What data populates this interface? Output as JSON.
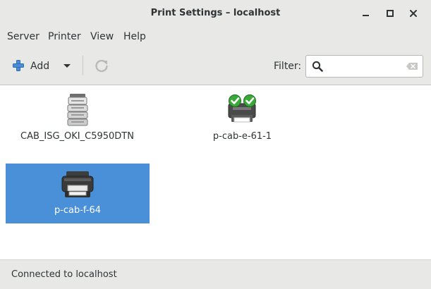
{
  "window": {
    "title": "Print Settings – localhost"
  },
  "menu": {
    "items": [
      {
        "label": "Server"
      },
      {
        "label": "Printer"
      },
      {
        "label": "View"
      },
      {
        "label": "Help"
      }
    ]
  },
  "toolbar": {
    "add_label": "Add",
    "filter_label": "Filter:",
    "filter_value": "",
    "filter_placeholder": ""
  },
  "printers": [
    {
      "name": "CAB_ISG_OKI_C5950DTN",
      "icon": "network-printer-icon",
      "selected": false
    },
    {
      "name": "p-cab-e-61-1",
      "icon": "printer-group-icon",
      "selected": false
    },
    {
      "name": "p-cab-f-64",
      "icon": "printer-icon",
      "selected": true
    }
  ],
  "status": {
    "text": "Connected to localhost"
  },
  "colors": {
    "selection": "#4a90d9",
    "chrome": "#e8e8e7",
    "check_green": "#3aa83a"
  }
}
